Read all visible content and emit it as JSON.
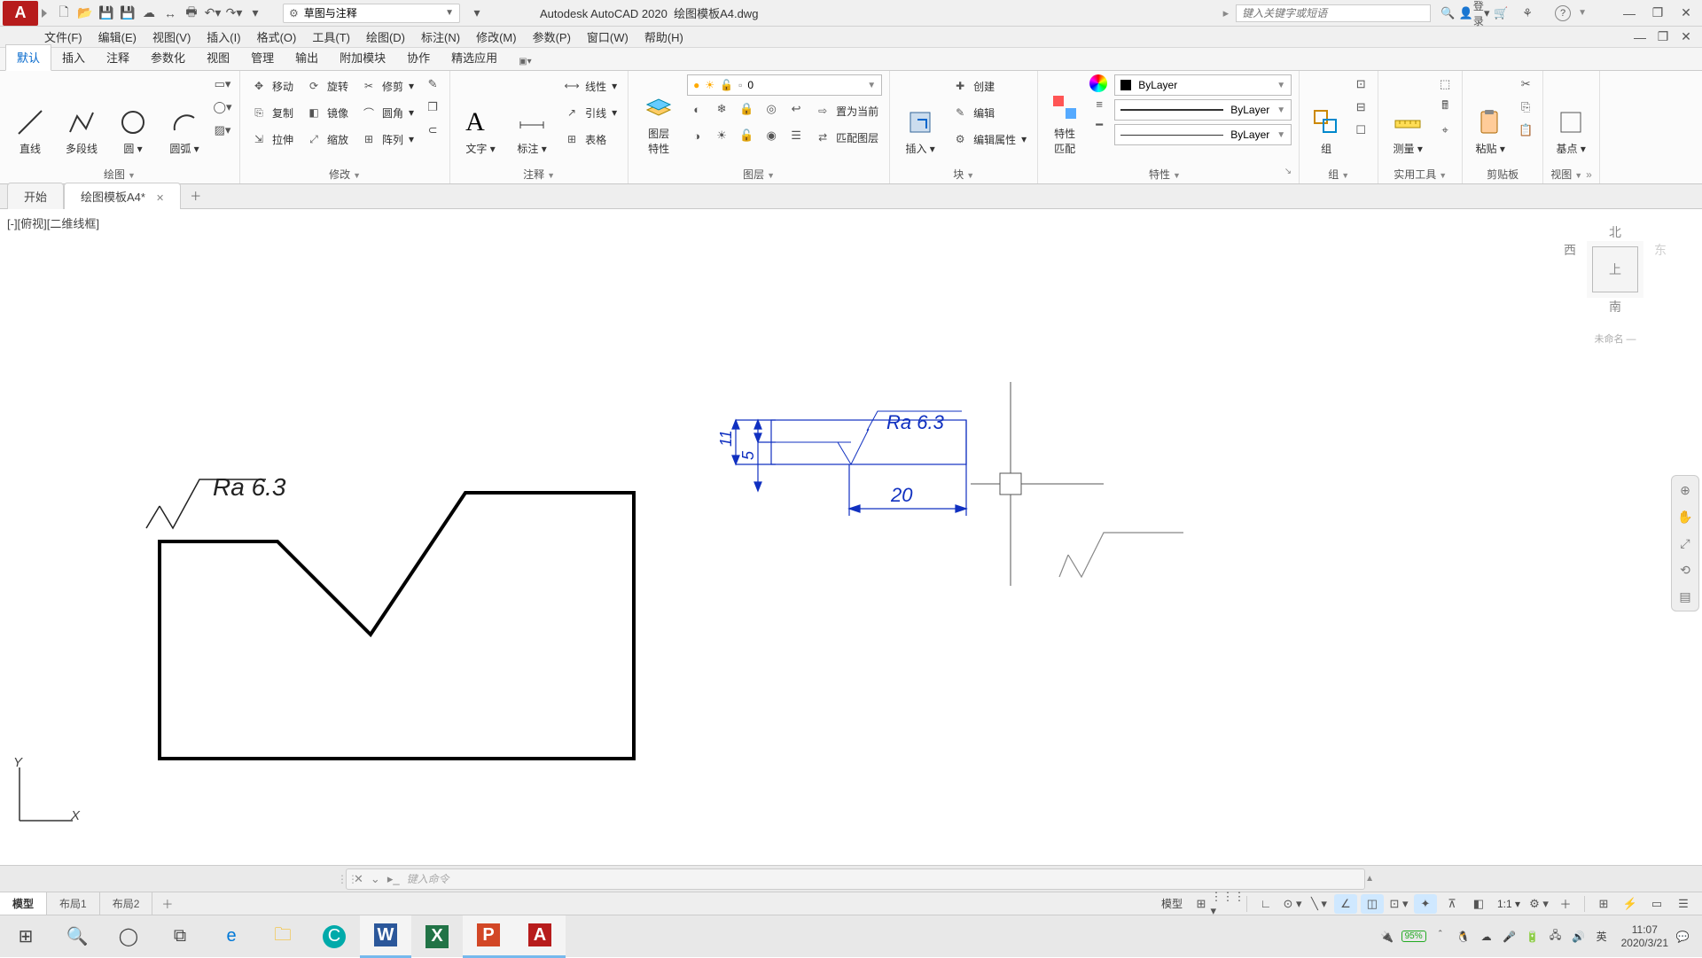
{
  "app": {
    "logo": "A",
    "title_prefix": "Autodesk AutoCAD 2020",
    "filename": "绘图模板A4.dwg"
  },
  "qat": [
    "new",
    "open",
    "save",
    "saveall",
    "plot",
    "undo",
    "redo"
  ],
  "workspace": {
    "label": "草图与注释"
  },
  "search": {
    "placeholder": "键入关键字或短语"
  },
  "login": "登录",
  "menus": [
    "文件(F)",
    "编辑(E)",
    "视图(V)",
    "插入(I)",
    "格式(O)",
    "工具(T)",
    "绘图(D)",
    "标注(N)",
    "修改(M)",
    "参数(P)",
    "窗口(W)",
    "帮助(H)"
  ],
  "ribtabs": [
    "默认",
    "插入",
    "注释",
    "参数化",
    "视图",
    "管理",
    "输出",
    "附加模块",
    "协作",
    "精选应用"
  ],
  "ribtab_active": 0,
  "panels": {
    "draw": {
      "title": "绘图",
      "line": "直线",
      "polyline": "多段线",
      "circle": "圆",
      "arc": "圆弧"
    },
    "modify": {
      "title": "修改",
      "move": "移动",
      "rotate": "旋转",
      "trim": "修剪",
      "copy": "复制",
      "mirror": "镜像",
      "fillet": "圆角",
      "stretch": "拉伸",
      "scale": "缩放",
      "array": "阵列"
    },
    "annot": {
      "title": "注释",
      "text": "文字",
      "dim": "标注",
      "linear": "线性",
      "leader": "引线",
      "table": "表格"
    },
    "layers": {
      "title": "图层",
      "big": "图层\n特性",
      "current": "0",
      "setcur": "置为当前",
      "match": "匹配图层"
    },
    "block": {
      "title": "块",
      "insert": "插入",
      "create": "创建",
      "edit": "编辑",
      "attr": "编辑属性"
    },
    "props": {
      "title": "特性",
      "big": "特性\n匹配",
      "bylayer": "ByLayer"
    },
    "group": {
      "title": "组"
    },
    "util": {
      "title": "实用工具",
      "measure": "测量"
    },
    "clip": {
      "title": "剪贴板",
      "paste": "粘贴"
    },
    "view": {
      "title": "视图",
      "base": "基点"
    }
  },
  "doctabs": {
    "start": "开始",
    "file": "绘图模板A4*"
  },
  "viewport": "[-][俯视][二维线框]",
  "navcube": {
    "n": "北",
    "w": "西",
    "top": "上",
    "e": "东",
    "s": "南",
    "unnamed": "未命名 —"
  },
  "drawing": {
    "ra": "Ra 6.3",
    "d11": "11",
    "d5": "5",
    "d20": "20"
  },
  "cmd": {
    "prompt": "键入命令"
  },
  "layout": {
    "model": "模型",
    "l1": "布局1",
    "l2": "布局2",
    "label": "模型"
  },
  "status": {
    "scale": "1:1",
    "ime": "英"
  },
  "taskbar": {
    "battery": "95%",
    "time": "11:07",
    "date": "2020/3/21"
  }
}
